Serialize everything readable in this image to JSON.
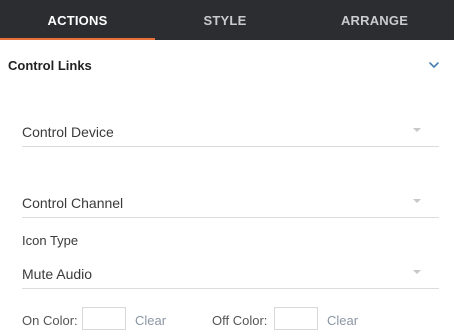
{
  "tabs": [
    {
      "label": "ACTIONS",
      "active": true
    },
    {
      "label": "STYLE",
      "active": false
    },
    {
      "label": "ARRANGE",
      "active": false
    }
  ],
  "accent_color": "#e8703a",
  "section": {
    "title": "Control Links",
    "toggle_icon": "chevron-down-icon"
  },
  "fields": {
    "control_device": {
      "value": "Control Device"
    },
    "control_channel": {
      "value": "Control Channel"
    },
    "icon_type": {
      "label": "Icon Type",
      "value": "Mute Audio"
    }
  },
  "colors": {
    "on_label": "On Color:",
    "off_label": "Off Color:",
    "clear_label": "Clear"
  }
}
